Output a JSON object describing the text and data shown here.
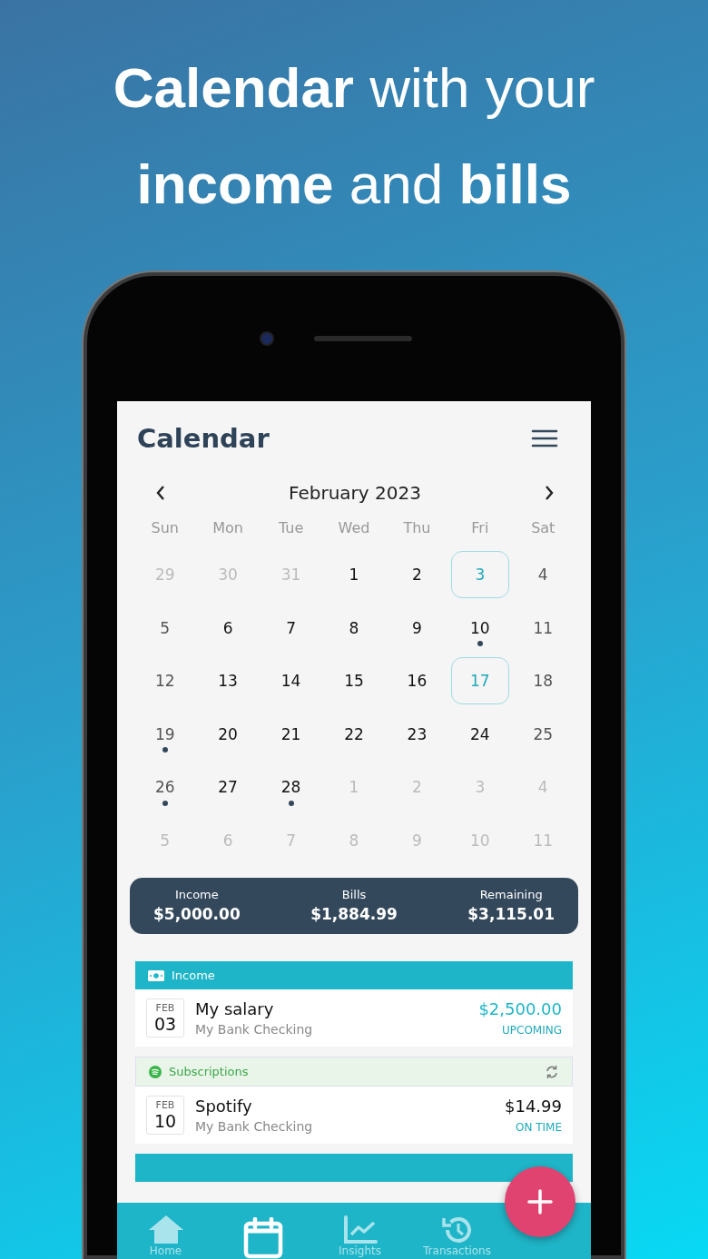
{
  "headline": [
    "**Calendar** with your",
    "**income** and **bills**"
  ],
  "app": {
    "title": "Calendar",
    "month": "February 2023",
    "weekdays": [
      "Sun",
      "Mon",
      "Tue",
      "Wed",
      "Thu",
      "Fri",
      "Sat"
    ],
    "days": [
      {
        "day": "29",
        "in_month": false,
        "selected": false,
        "dot": false
      },
      {
        "day": "30",
        "in_month": false,
        "selected": false,
        "dot": false
      },
      {
        "day": "31",
        "in_month": false,
        "selected": false,
        "dot": false
      },
      {
        "day": "1",
        "in_month": true,
        "selected": false,
        "dot": false
      },
      {
        "day": "2",
        "in_month": true,
        "selected": false,
        "dot": false
      },
      {
        "day": "3",
        "in_month": true,
        "selected": true,
        "dot": false
      },
      {
        "day": "4",
        "in_month": true,
        "selected": false,
        "dot": false
      },
      {
        "day": "5",
        "in_month": true,
        "selected": false,
        "dot": false
      },
      {
        "day": "6",
        "in_month": true,
        "selected": false,
        "dot": false
      },
      {
        "day": "7",
        "in_month": true,
        "selected": false,
        "dot": false
      },
      {
        "day": "8",
        "in_month": true,
        "selected": false,
        "dot": false
      },
      {
        "day": "9",
        "in_month": true,
        "selected": false,
        "dot": false
      },
      {
        "day": "10",
        "in_month": true,
        "selected": false,
        "dot": true
      },
      {
        "day": "11",
        "in_month": true,
        "selected": false,
        "dot": false
      },
      {
        "day": "12",
        "in_month": true,
        "selected": false,
        "dot": false
      },
      {
        "day": "13",
        "in_month": true,
        "selected": false,
        "dot": false
      },
      {
        "day": "14",
        "in_month": true,
        "selected": false,
        "dot": false
      },
      {
        "day": "15",
        "in_month": true,
        "selected": false,
        "dot": false
      },
      {
        "day": "16",
        "in_month": true,
        "selected": false,
        "dot": false
      },
      {
        "day": "17",
        "in_month": true,
        "selected": true,
        "dot": false
      },
      {
        "day": "18",
        "in_month": true,
        "selected": false,
        "dot": false
      },
      {
        "day": "19",
        "in_month": true,
        "selected": false,
        "dot": true
      },
      {
        "day": "20",
        "in_month": true,
        "selected": false,
        "dot": false
      },
      {
        "day": "21",
        "in_month": true,
        "selected": false,
        "dot": false
      },
      {
        "day": "22",
        "in_month": true,
        "selected": false,
        "dot": false
      },
      {
        "day": "23",
        "in_month": true,
        "selected": false,
        "dot": false
      },
      {
        "day": "24",
        "in_month": true,
        "selected": false,
        "dot": false
      },
      {
        "day": "25",
        "in_month": true,
        "selected": false,
        "dot": false
      },
      {
        "day": "26",
        "in_month": true,
        "selected": false,
        "dot": true
      },
      {
        "day": "27",
        "in_month": true,
        "selected": false,
        "dot": false
      },
      {
        "day": "28",
        "in_month": true,
        "selected": false,
        "dot": true
      },
      {
        "day": "1",
        "in_month": false,
        "selected": false,
        "dot": false
      },
      {
        "day": "2",
        "in_month": false,
        "selected": false,
        "dot": false
      },
      {
        "day": "3",
        "in_month": false,
        "selected": false,
        "dot": false
      },
      {
        "day": "4",
        "in_month": false,
        "selected": false,
        "dot": false
      },
      {
        "day": "5",
        "in_month": false,
        "selected": false,
        "dot": false
      },
      {
        "day": "6",
        "in_month": false,
        "selected": false,
        "dot": false
      },
      {
        "day": "7",
        "in_month": false,
        "selected": false,
        "dot": false
      },
      {
        "day": "8",
        "in_month": false,
        "selected": false,
        "dot": false
      },
      {
        "day": "9",
        "in_month": false,
        "selected": false,
        "dot": false
      },
      {
        "day": "10",
        "in_month": false,
        "selected": false,
        "dot": false
      },
      {
        "day": "11",
        "in_month": false,
        "selected": false,
        "dot": false
      }
    ],
    "summary": [
      {
        "label": "Income",
        "amount": "$5,000.00"
      },
      {
        "label": "Bills",
        "amount": "$1,884.99"
      },
      {
        "label": "Remaining",
        "amount": "$3,115.01"
      }
    ],
    "sections": [
      {
        "kind": "income",
        "title": "Income",
        "items": [
          {
            "month": "FEB",
            "day": "03",
            "name": "My salary",
            "account": "My Bank Checking",
            "amount": "$2,500.00",
            "status": "UPCOMING"
          }
        ]
      },
      {
        "kind": "subscription",
        "title": "Subscriptions",
        "items": [
          {
            "month": "FEB",
            "day": "10",
            "name": "Spotify",
            "account": "My Bank Checking",
            "amount": "$14.99",
            "status": "ON TIME"
          }
        ]
      },
      {
        "kind": "income"
      }
    ],
    "nav": [
      {
        "label": "Home",
        "selected": false
      },
      {
        "selected": true
      },
      {
        "label": "Insights",
        "selected": false
      },
      {
        "label": "Transactions",
        "selected": false
      }
    ]
  }
}
